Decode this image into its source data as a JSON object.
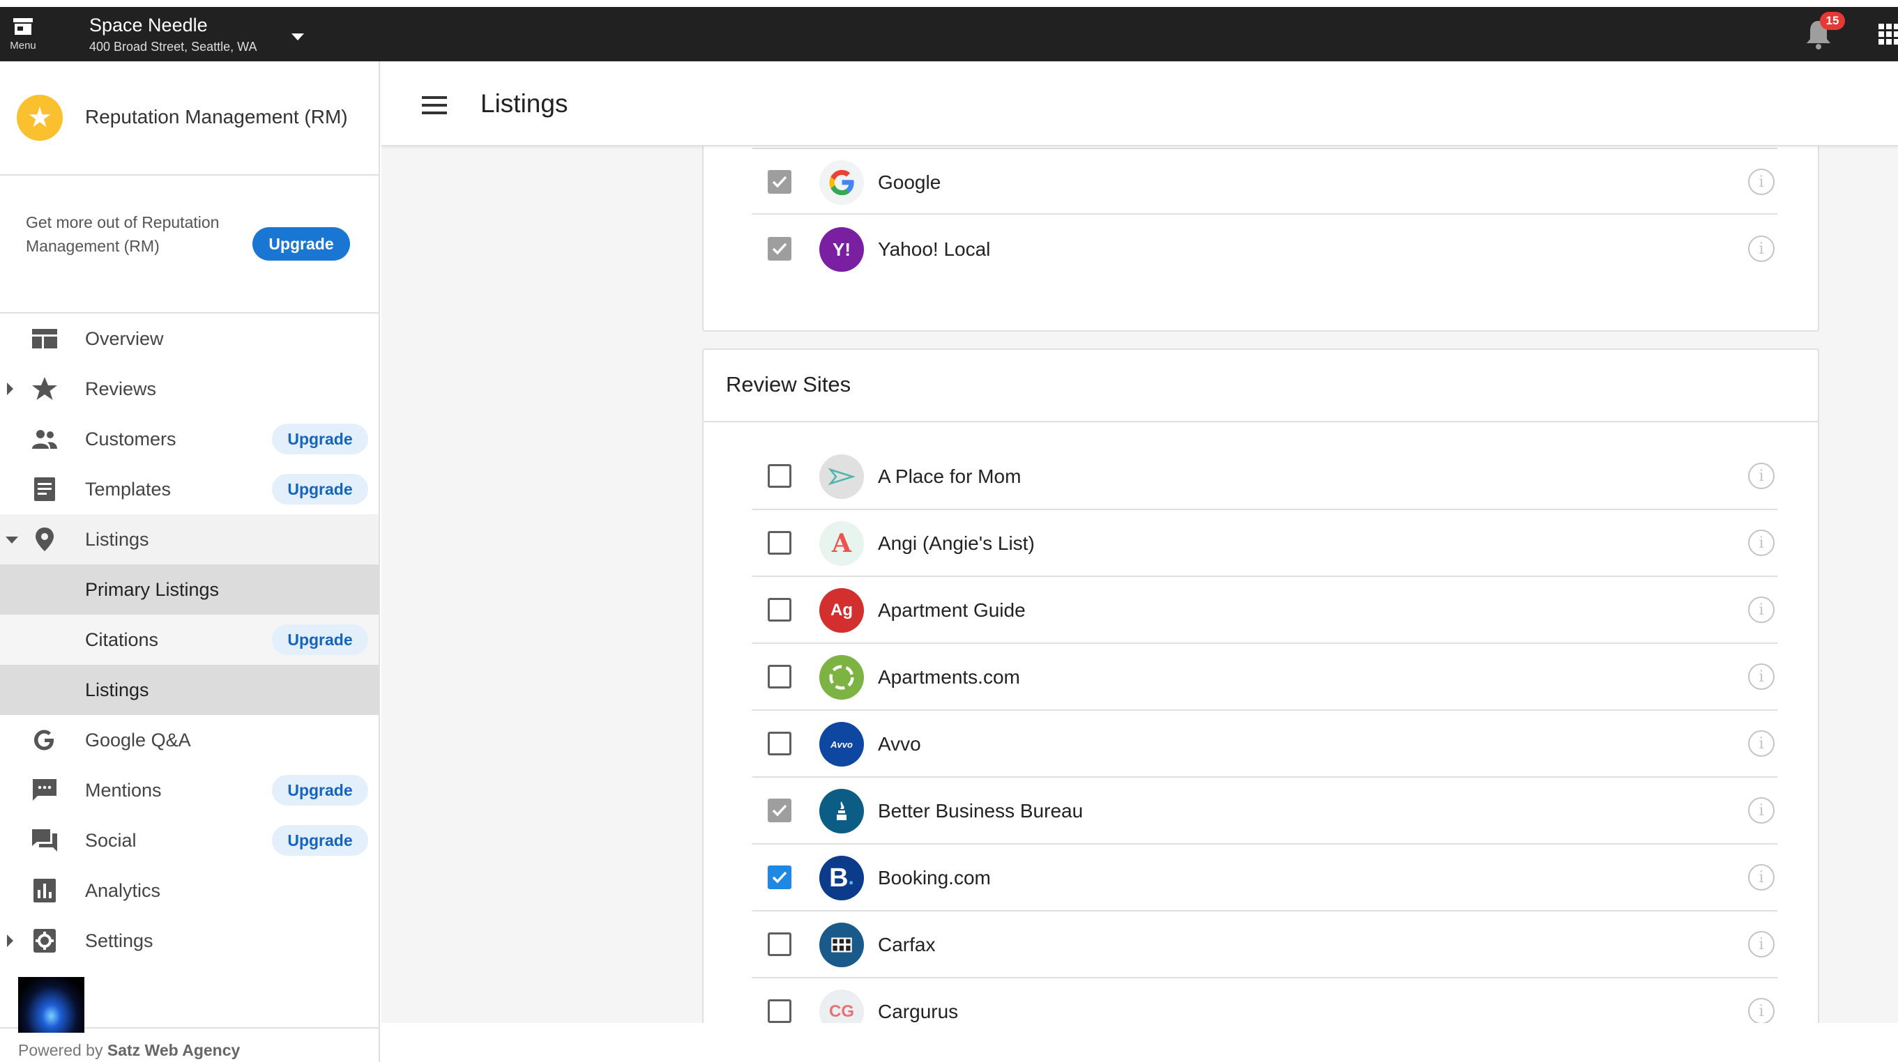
{
  "topbar": {
    "menu_label": "Menu",
    "business_name": "Space Needle",
    "business_address": "400 Broad Street, Seattle, WA",
    "notification_count": "15"
  },
  "sidebar": {
    "app_title": "Reputation Management (RM)",
    "promo_text": "Get more out of Reputation Management (RM)",
    "promo_button": "Upgrade",
    "items": [
      {
        "label": "Overview",
        "icon": "dashboard-icon"
      },
      {
        "label": "Reviews",
        "icon": "star-icon"
      },
      {
        "label": "Customers",
        "icon": "people-icon",
        "chip": "Upgrade"
      },
      {
        "label": "Templates",
        "icon": "document-icon",
        "chip": "Upgrade"
      },
      {
        "label": "Listings",
        "icon": "location-pin-icon"
      },
      {
        "label": "Primary Listings"
      },
      {
        "label": "Citations",
        "chip": "Upgrade"
      },
      {
        "label": "Listings"
      },
      {
        "label": "Google Q&A",
        "icon": "google-icon"
      },
      {
        "label": "Mentions",
        "icon": "chat-bubble-icon",
        "chip": "Upgrade"
      },
      {
        "label": "Social",
        "icon": "forum-icon",
        "chip": "Upgrade"
      },
      {
        "label": "Analytics",
        "icon": "bar-chart-icon"
      },
      {
        "label": "Settings",
        "icon": "settings-icon"
      }
    ],
    "powered_prefix": "Powered by",
    "powered_agency": "Satz Web Agency"
  },
  "main": {
    "page_title": "Listings",
    "top_card_sites": [
      {
        "name": "Google",
        "checked": "grey",
        "color": "#f1f3f4"
      },
      {
        "name": "Yahoo! Local",
        "checked": "grey",
        "color": "#7b1fa2"
      }
    ],
    "review_sites_title": "Review Sites",
    "review_sites": [
      {
        "name": "A Place for Mom",
        "checked": "none",
        "color": "#e0e0e0"
      },
      {
        "name": "Angi (Angie's List)",
        "checked": "none",
        "color": "#e8f5ee"
      },
      {
        "name": "Apartment Guide",
        "checked": "none",
        "color": "#d32f2f"
      },
      {
        "name": "Apartments.com",
        "checked": "none",
        "color": "#7cb342"
      },
      {
        "name": "Avvo",
        "checked": "none",
        "color": "#0d47a1"
      },
      {
        "name": "Better Business Bureau",
        "checked": "grey",
        "color": "#0b5d85"
      },
      {
        "name": "Booking.com",
        "checked": "blue",
        "color": "#0d3b8c"
      },
      {
        "name": "Carfax",
        "checked": "none",
        "color": "#1a5a8a"
      },
      {
        "name": "Cargurus",
        "checked": "none",
        "color": "#eceff1"
      }
    ]
  }
}
